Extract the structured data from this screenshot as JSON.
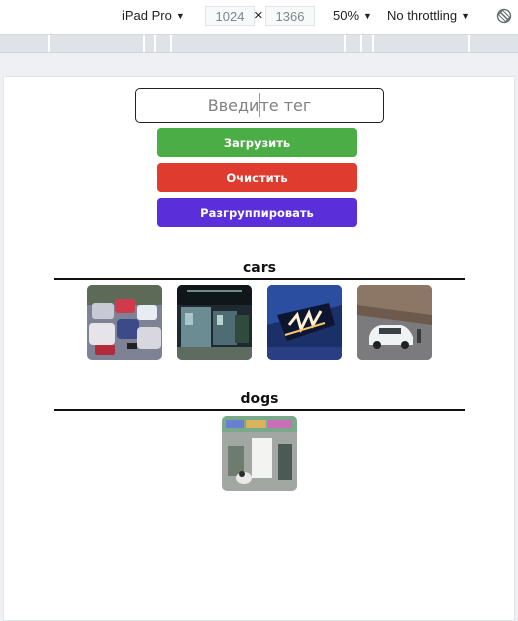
{
  "devtools": {
    "device": "iPad Pro",
    "width": "1024",
    "height": "1366",
    "times_symbol": "×",
    "zoom": "50%",
    "throttling": "No throttling",
    "caret": "▼"
  },
  "form": {
    "tag_placeholder": "Введите тег",
    "upload_label": "Загрузить",
    "clear_label": "Очистить",
    "ungroup_label": "Разгруппировать"
  },
  "colors": {
    "upload": "#4aad45",
    "clear": "#df3b2e",
    "ungroup": "#5a2fd9"
  },
  "groups": [
    {
      "title": "cars",
      "images": [
        "race-cars-photo",
        "bus-station-photo",
        "car-headlight-photo",
        "white-suv-photo"
      ]
    },
    {
      "title": "dogs",
      "images": [
        "dog-meme-photo"
      ]
    }
  ]
}
